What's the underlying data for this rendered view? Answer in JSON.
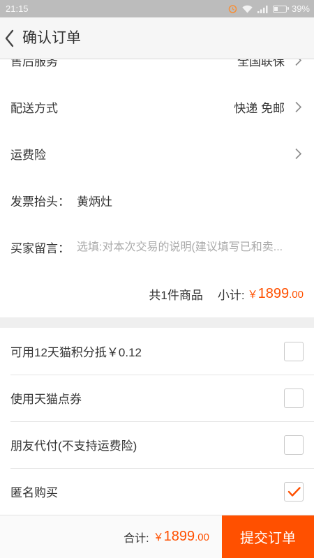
{
  "status_bar": {
    "time": "21:15",
    "battery_percent": "39%",
    "battery_level": 0.39,
    "icons": [
      "alarm-icon",
      "wifi-icon",
      "signal-icon",
      "battery-icon"
    ]
  },
  "header": {
    "title": "确认订单",
    "back_icon": "chevron-left-icon"
  },
  "order_details": {
    "after_sales": {
      "label": "售后服务",
      "value": "全国联保",
      "icon": "chevron-right-icon"
    },
    "delivery": {
      "label": "配送方式",
      "value": "快递 免邮",
      "icon": "chevron-right-icon"
    },
    "shipping_insurance": {
      "label": "运费险",
      "icon": "chevron-right-icon"
    },
    "invoice": {
      "label": "发票抬头：",
      "value": "黄炳灶"
    },
    "buyer_message": {
      "label": "买家留言：",
      "placeholder": "选填:对本次交易的说明(建议填写已和卖..."
    },
    "summary": {
      "item_count_text": "共1件商品",
      "subtotal_label": "小计:",
      "currency": "￥",
      "price_integer": "1899",
      "price_decimal": ".00"
    }
  },
  "options": [
    {
      "label": "可用12天猫积分抵￥0.12",
      "checked": false
    },
    {
      "label": "使用天猫点券",
      "checked": false
    },
    {
      "label": "朋友代付(不支持运费险)",
      "checked": false
    },
    {
      "label": "匿名购买",
      "checked": true
    }
  ],
  "footer": {
    "total_label": "合计:",
    "currency": "￥",
    "price_integer": "1899",
    "price_decimal": ".00",
    "submit_label": "提交订单"
  },
  "colors": {
    "accent": "#ff5000",
    "text": "#333333",
    "placeholder": "#aaaaaa"
  }
}
